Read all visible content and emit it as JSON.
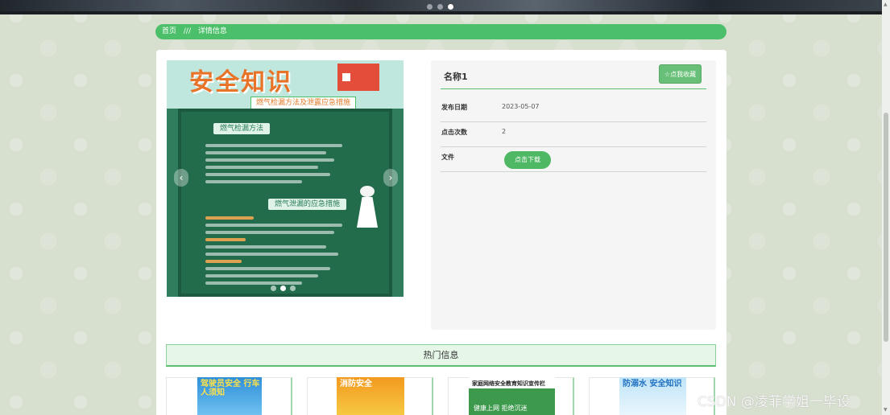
{
  "breadcrumb": {
    "home": "首页",
    "separator": "///",
    "current": "详情信息"
  },
  "carousel": {
    "poster_title": "安全知识",
    "poster_subtitle": "燃气检漏方法及泄露应急措施",
    "heading_1": "燃气检漏方法",
    "heading_2": "燃气泄漏的应急措施",
    "slide_count": 3,
    "active_index": 1
  },
  "detail": {
    "name": "名称1",
    "favorite_label": "☆点我收藏",
    "fields": [
      {
        "label": "发布日期",
        "value": "2023-05-07"
      },
      {
        "label": "点击次数",
        "value": "2"
      },
      {
        "label": "文件",
        "value": ""
      }
    ],
    "download_label": "点击下载"
  },
  "hot": {
    "title": "热门信息",
    "items": [
      {
        "title": "驾驶员安全 行车人须知"
      },
      {
        "title": "消防安全"
      },
      {
        "title": "家庭网络安全教育知识宣传栏",
        "sub": "健康上网 拒绝沉迷"
      },
      {
        "title": "防溺水 安全知识"
      }
    ]
  },
  "watermark": "CSDN @凌菲学姐一毕设",
  "colors": {
    "brand_green": "#4cbf6a",
    "button_green": "#68bf77"
  }
}
